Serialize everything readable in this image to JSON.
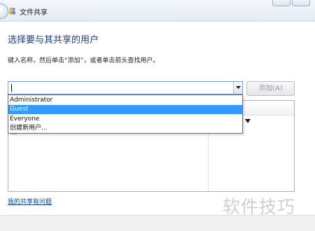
{
  "window": {
    "title": "文件共享"
  },
  "main": {
    "heading": "选择要与其共享的用户",
    "instruction": "键入名称，然后单击“添加”，或者单击箭头查找用户。",
    "combo_value": "",
    "add_button_label": "添加(A)",
    "help_link": "我的共享有问题"
  },
  "dropdown": {
    "options": [
      "Administrator",
      "Guest",
      "Everyone",
      "创建新用户..."
    ],
    "selected": "Guest"
  },
  "watermark": "软件技巧",
  "colors": {
    "heading": "#1a3e8c",
    "selection": "#3399ff",
    "link": "#0645ad"
  }
}
